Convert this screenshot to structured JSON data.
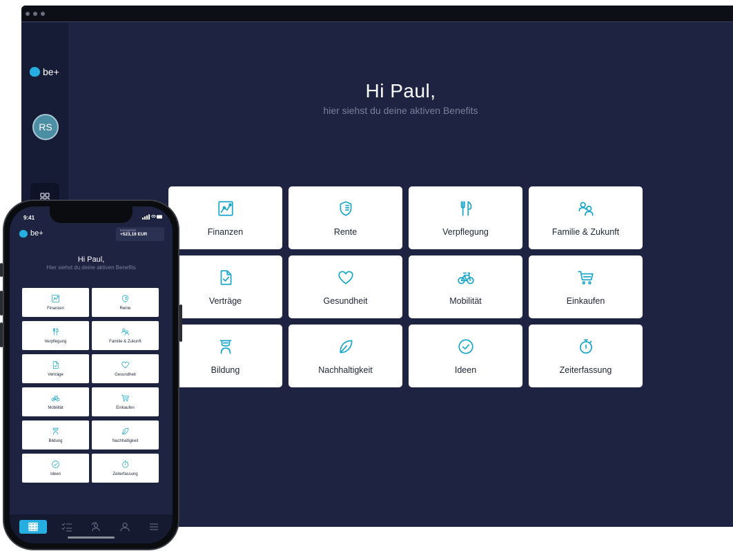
{
  "desktop": {
    "logo_text": "be+",
    "avatar_initials": "RS",
    "greeting": "Hi Paul,",
    "subtitle": "hier siehst du deine aktiven Benefits",
    "benefits": [
      {
        "label": "Finanzen",
        "icon": "chart-icon"
      },
      {
        "label": "Rente",
        "icon": "shield-icon"
      },
      {
        "label": "Verpflegung",
        "icon": "cutlery-icon"
      },
      {
        "label": "Familie & Zukunft",
        "icon": "people-icon"
      },
      {
        "label": "Verträge",
        "icon": "document-check-icon"
      },
      {
        "label": "Gesundheit",
        "icon": "heart-icon"
      },
      {
        "label": "Mobilität",
        "icon": "bicycle-icon"
      },
      {
        "label": "Einkaufen",
        "icon": "cart-icon"
      },
      {
        "label": "Bildung",
        "icon": "graduation-icon"
      },
      {
        "label": "Nachhaltigkeit",
        "icon": "leaf-icon"
      },
      {
        "label": "Ideen",
        "icon": "check-circle-icon"
      },
      {
        "label": "Zeiterfassung",
        "icon": "stopwatch-icon"
      }
    ]
  },
  "phone": {
    "time": "9:41",
    "logo_text": "be+",
    "extra_label": "Extragehalt",
    "extra_value": "+523,19 EUR",
    "greeting": "Hi Paul,",
    "subtitle": "Hier siehst du deine aktiven Benefits",
    "benefits": [
      {
        "label": "Finanzen",
        "icon": "chart-icon"
      },
      {
        "label": "Rente",
        "icon": "shield-icon"
      },
      {
        "label": "Verpflegung",
        "icon": "cutlery-icon"
      },
      {
        "label": "Familie & Zukunft",
        "icon": "people-icon"
      },
      {
        "label": "Verträge",
        "icon": "document-check-icon"
      },
      {
        "label": "Gesundheit",
        "icon": "heart-icon"
      },
      {
        "label": "Mobilität",
        "icon": "bicycle-icon"
      },
      {
        "label": "Einkaufen",
        "icon": "cart-icon"
      },
      {
        "label": "Bildung",
        "icon": "graduation-icon"
      },
      {
        "label": "Nachhaltigkeit",
        "icon": "leaf-icon"
      },
      {
        "label": "Ideen",
        "icon": "check-circle-icon"
      },
      {
        "label": "Zeiterfassung",
        "icon": "stopwatch-icon"
      }
    ],
    "tabs": [
      {
        "icon": "grid-icon",
        "active": true
      },
      {
        "icon": "checklist-icon",
        "active": false
      },
      {
        "icon": "user-refresh-icon",
        "active": false
      },
      {
        "icon": "person-icon",
        "active": false
      },
      {
        "icon": "menu-icon",
        "active": false
      }
    ]
  },
  "colors": {
    "background": "#1d2340",
    "sidebar": "#171c36",
    "accent": "#1aa7c9",
    "brand_blue": "#27aee0",
    "card": "#ffffff"
  }
}
